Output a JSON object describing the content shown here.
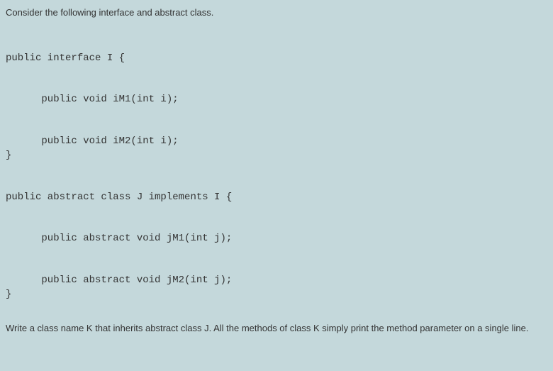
{
  "intro": "Consider the following interface and abstract class.",
  "code": {
    "line1": "public interface I {",
    "line2": "      public void iM1(int i);",
    "line3": "      public void iM2(int i);",
    "line4": "}",
    "line5": "public abstract class J implements I {",
    "line6": "      public abstract void jM1(int j);",
    "line7": "      public abstract void jM2(int j);",
    "line8": "}"
  },
  "instruction": "Write a class name K that inherits abstract class J.  All the methods of class K simply print the method parameter on a single line."
}
